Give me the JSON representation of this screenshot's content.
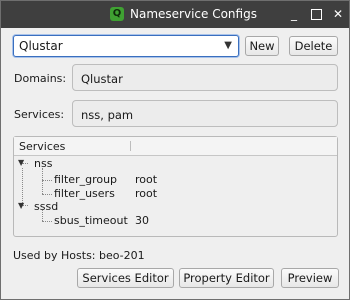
{
  "window": {
    "title": "Nameservice Configs",
    "app_icon_glyph": "Q",
    "minimize_glyph": "_",
    "close_glyph": "✕"
  },
  "selector": {
    "selected": "Qlustar",
    "new_label": "New",
    "delete_label": "Delete"
  },
  "domains": {
    "label": "Domains:",
    "value": "Qlustar"
  },
  "services": {
    "label": "Services:",
    "value": "nss, pam"
  },
  "tree": {
    "header": "Services",
    "rows": [
      {
        "name": "nss",
        "value": ""
      },
      {
        "name": "filter_group",
        "value": "root"
      },
      {
        "name": "filter_users",
        "value": "root"
      },
      {
        "name": "sssd",
        "value": ""
      },
      {
        "name": "sbus_timeout",
        "value": "30"
      }
    ]
  },
  "used_by": "Used by Hosts: beo-201",
  "buttons": {
    "services_editor": "Services Editor",
    "property_editor": "Property Editor",
    "preview": "Preview"
  },
  "colors": {
    "titlebar": "#3f3f3f",
    "focus": "#3a6fbf",
    "app_icon": "#3fa132"
  }
}
